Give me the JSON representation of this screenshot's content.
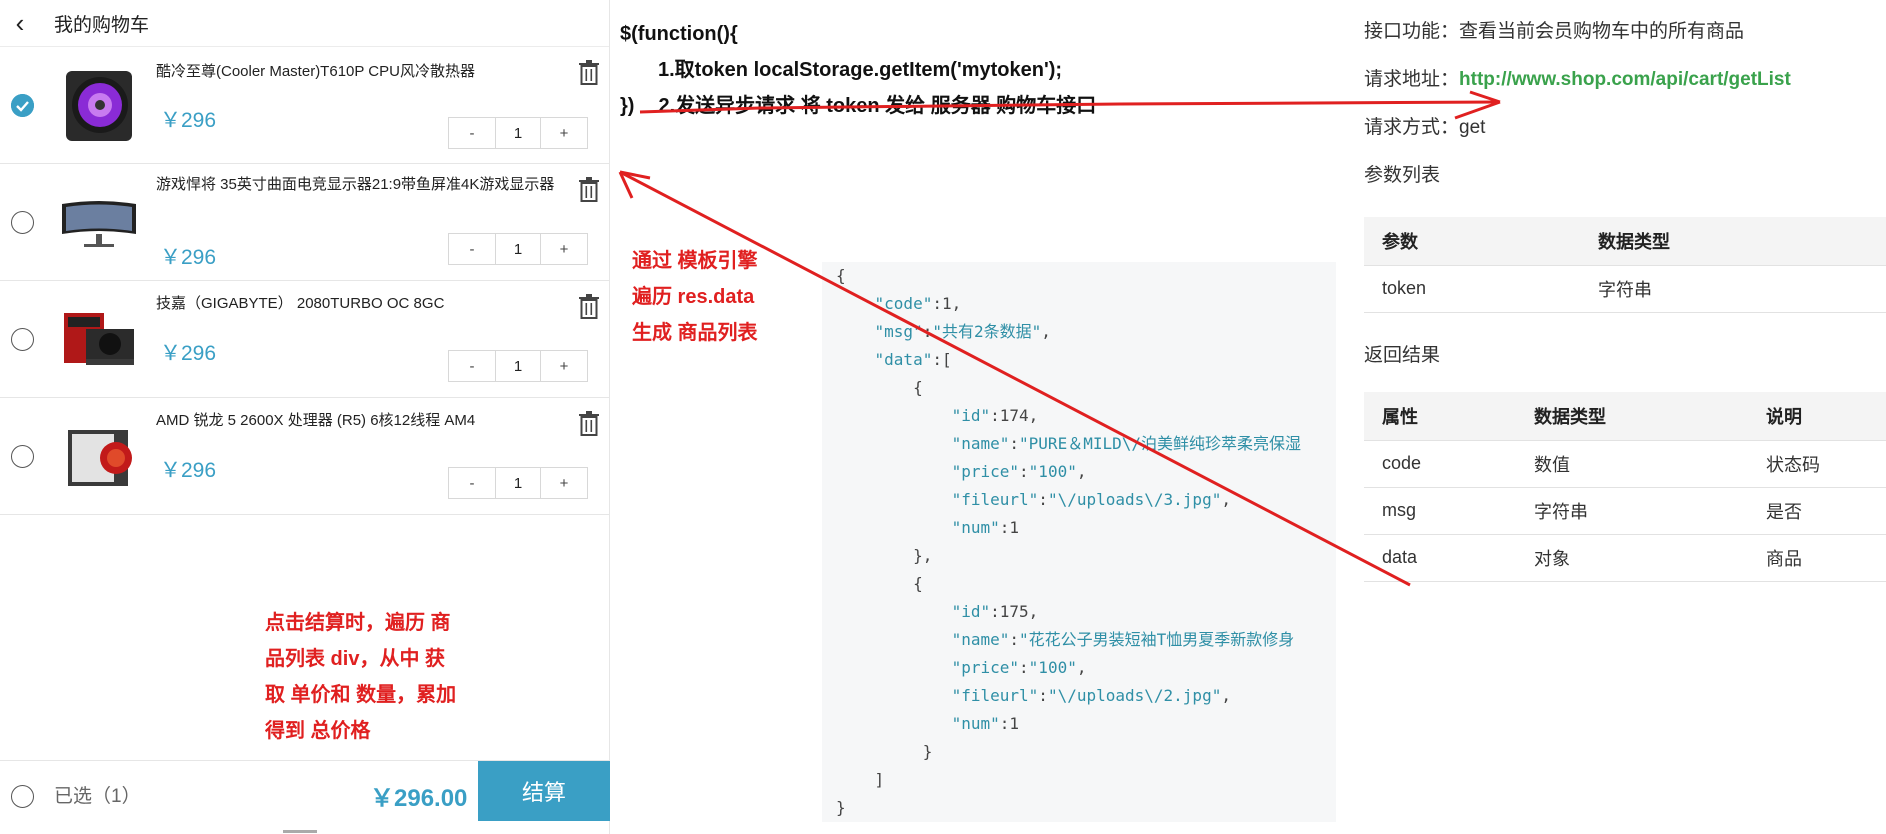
{
  "cart": {
    "title": "我的购物车",
    "items": [
      {
        "name": "酷冷至尊(Cooler Master)T610P CPU风冷散热器",
        "price": "￥296",
        "qty": "1",
        "checked": true
      },
      {
        "name": "游戏悍将 35英寸曲面电竞显示器21:9带鱼屏准4K游戏显示器",
        "price": "￥296",
        "qty": "1",
        "checked": false
      },
      {
        "name": "技嘉（GIGABYTE） 2080TURBO OC 8GC",
        "price": "￥296",
        "qty": "1",
        "checked": false
      },
      {
        "name": "AMD 锐龙 5 2600X 处理器 (R5) 6核12线程 AM4",
        "price": "￥296",
        "qty": "1",
        "checked": false
      }
    ],
    "minus": "-",
    "plus": "+",
    "footer": {
      "selected": "已选（1）",
      "total": "￥296.00",
      "checkout": "结算"
    },
    "accent": "#3a9fc5"
  },
  "code": {
    "line1": "$(function(){",
    "line2": "1.取token localStorage.getItem('mytoken');",
    "line3a": "})",
    "line3b": "2.发送异步请求 将 token 发给 服务器 购物车接口"
  },
  "notes": {
    "template": [
      "通过 模板引擎",
      "遍历 res.data",
      "生成 商品列表"
    ],
    "checkout": [
      "点击结算时，遍历 商",
      "品列表 div，从中 获",
      "取 单价和 数量，累加",
      "得到 总价格"
    ],
    "color": "#e02020"
  },
  "json_sample": {
    "code_key": "\"code\"",
    "code_val": ":1,",
    "msg_key": "\"msg\"",
    "msg_val": "\"共有2条数据\"",
    "data_key": "\"data\"",
    "items": [
      {
        "id": "174",
        "name": "\"PURE＆MILD\\/泊美鲜纯珍萃柔亮保湿",
        "price": "\"100\"",
        "fileurl": "\"\\/uploads\\/3.jpg\"",
        "num": "1"
      },
      {
        "id": "175",
        "name": "\"花花公子男装短袖T恤男夏季新款修身",
        "price": "\"100\"",
        "fileurl": "\"\\/uploads\\/2.jpg\"",
        "num": "1"
      }
    ]
  },
  "api": {
    "function_label": "接口功能：",
    "function_value": "查看当前会员购物车中的所有商品",
    "url_label": "请求地址：",
    "url_value": "http://www.shop.com/api/cart/getList",
    "method_label": "请求方式：",
    "method_value": "get",
    "params_title": "参数列表",
    "params_headers": [
      "参数",
      "数据类型"
    ],
    "params_rows": [
      [
        "token",
        "字符串"
      ]
    ],
    "result_title": "返回结果",
    "result_headers": [
      "属性",
      "数据类型",
      "说明"
    ],
    "result_rows": [
      [
        "code",
        "数值",
        "状态码"
      ],
      [
        "msg",
        "字符串",
        "是否"
      ],
      [
        "data",
        "对象",
        "商品"
      ]
    ],
    "link_color": "#3aa24c"
  }
}
